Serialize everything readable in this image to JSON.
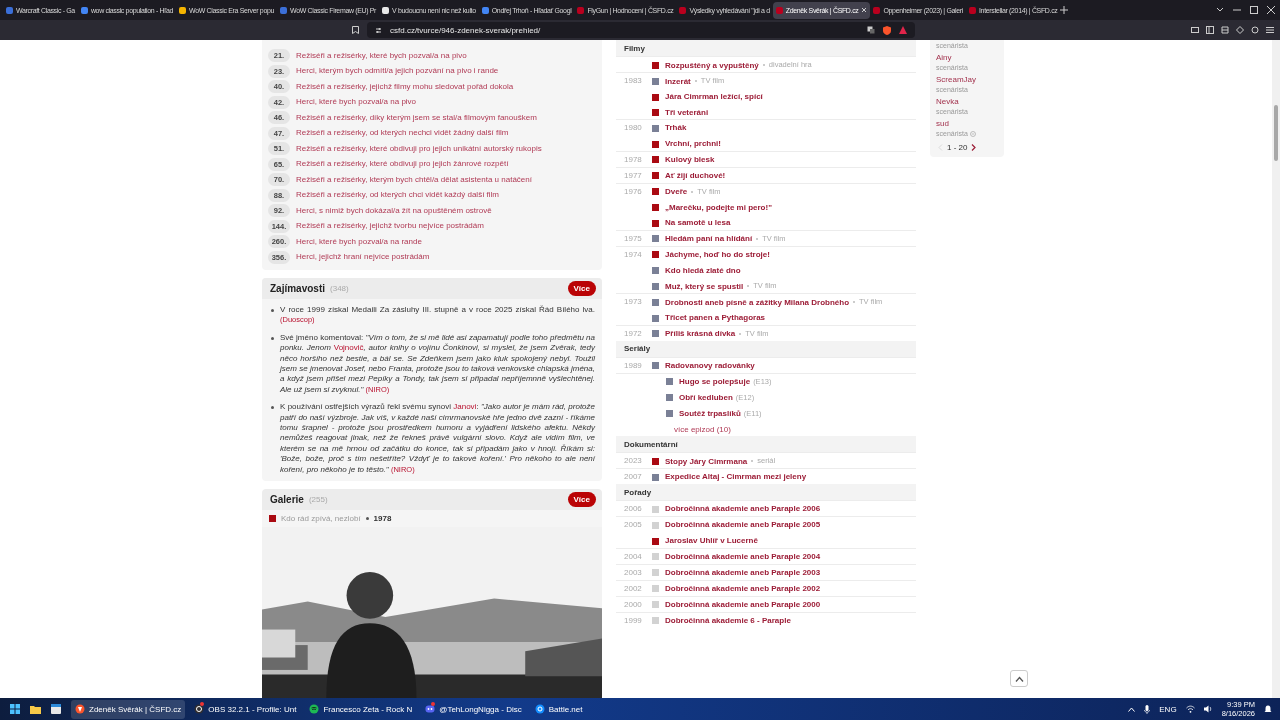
{
  "browser": {
    "tabs": [
      {
        "title": "Warcraft Classic - Ga",
        "selected": false
      },
      {
        "title": "wow classic population - Hľad",
        "selected": false
      },
      {
        "title": "WoW Classic Era Server popu",
        "selected": false
      },
      {
        "title": "WoW Classic Firemaw (EU) Pr",
        "selected": false
      },
      {
        "title": "V budoucnu není nic než kulto",
        "selected": false
      },
      {
        "title": "Ondřej Trhoň - Hľadať Googl",
        "selected": false
      },
      {
        "title": "FlyGun | Hodnocení | ČSFD.cz",
        "selected": false
      },
      {
        "title": "Výsledky vyhledávání \"jdi a d",
        "selected": false
      },
      {
        "title": "Zdeněk Svěrák | ČSFD.cz",
        "selected": true
      },
      {
        "title": "Oppenheimer (2023) | Galeri",
        "selected": false
      },
      {
        "title": "Interstellar (2014) | ČSFD.cz",
        "selected": false
      }
    ],
    "address_bar": {
      "url": "csfd.cz/tvurce/946-zdenek-sverak/prehled/"
    }
  },
  "rankings": [
    {
      "rank": "21.",
      "label": "Režiséři a režisérky, které bych pozval/a na pivo"
    },
    {
      "rank": "23.",
      "label": "Herci, kterým bych odmítl/a jejich pozvání na pivo i rande"
    },
    {
      "rank": "40.",
      "label": "Režiséři a režisérky, jejichž filmy mohu sledovat pořád dokola"
    },
    {
      "rank": "42.",
      "label": "Herci, které bych pozval/a na pivo"
    },
    {
      "rank": "46.",
      "label": "Režiséři a režisérky, díky kterým jsem se stal/a filmovým fanouškem"
    },
    {
      "rank": "47.",
      "label": "Režiséři a režisérky, od kterých nechci vidět žádný další film"
    },
    {
      "rank": "51.",
      "label": "Režiséři a režisérky, které obdivuji pro jejich unikátní autorský rukopis"
    },
    {
      "rank": "65.",
      "label": "Režiséři a režisérky, které obdivuji pro jejich žánrové rozpětí"
    },
    {
      "rank": "70.",
      "label": "Režiséři a režisérky, kterým bych chtěl/a dělat asistenta u natáčení"
    },
    {
      "rank": "88.",
      "label": "Režiséři a režisérky, od kterých chci vidět každý další film"
    },
    {
      "rank": "92.",
      "label": "Herci, s nimiž bych dokázal/a žít na opuštěném ostrově"
    },
    {
      "rank": "144.",
      "label": "Režiséři a režisérky, jejichž tvorbu nejvíce postrádám"
    },
    {
      "rank": "260.",
      "label": "Herci, které bych pozval/a na rande"
    },
    {
      "rank": "356.",
      "label": "Herci, jejichž hraní nejvíce postrádám"
    }
  ],
  "trivia": {
    "title": "Zajímavosti",
    "count": "(348)",
    "more_button": "Více",
    "items": [
      {
        "segments": [
          {
            "kind": "text",
            "italic": false,
            "text": "V roce 1999 získal Medaili Za zásluhy III. stupně a v roce 2025 získal Řád Bílého lva. "
          },
          {
            "kind": "source",
            "italic": false,
            "text": "(Duoscop)"
          }
        ]
      },
      {
        "segments": [
          {
            "kind": "text",
            "italic": false,
            "text": "Své jméno komentoval: "
          },
          {
            "kind": "text",
            "italic": true,
            "text": "\"Vím o tom, že si mě lidé asi zapamatují podle toho předmětu na ponku. Jenom "
          },
          {
            "kind": "link",
            "italic": false,
            "text": "Vojnovič"
          },
          {
            "kind": "text",
            "italic": true,
            "text": ", autor knihy o vojínu Čonkinovi, si myslel, že jsem Zvěrak, tedy něco horšího než bestie, a bál se. Se Zdeňkem jsem jako kluk spokojený nebyl. Toužil jsem se jmenovat Josef, nebo Franta, protože jsou to taková venkovské chlapská jména, a když jsem přišel mezi Pepíky a Tondy, tak jsem si připadal nepříjemnně vyšlechtěnej. Ale už jsem si zvyknul.\" "
          },
          {
            "kind": "source",
            "italic": false,
            "text": "(NIRO)"
          }
        ]
      },
      {
        "segments": [
          {
            "kind": "text",
            "italic": false,
            "text": "K používání ostřejších výrazů řekl svému synovi "
          },
          {
            "kind": "link",
            "italic": false,
            "text": "Janovi"
          },
          {
            "kind": "text",
            "italic": false,
            "text": ": "
          },
          {
            "kind": "text",
            "italic": true,
            "text": "\"Jako autor je mám rád, protože patří do naší výzbroje. Jak víš, v každé naší cimrmanovské hře jedno dvě zazní - říkáme tomu šrapnel - protože jsou prostředkem humoru a vyjádření lidského afektu. Někdy nemůžeš reagovat jinak, než že řekneš právě vulgární slovo. Když ale vidím film, ve kterém se na mě hrnou od začátku do konce, tak si připadám jako v hnoji. Říkám si: 'Bože, bože, proč s tím nešetříte? Vždyť je to takové koření.' Pro někoho to ale není koření, pro někoho je to těsto.\" "
          },
          {
            "kind": "source",
            "italic": false,
            "text": "(NIRO)"
          }
        ]
      }
    ]
  },
  "gallery": {
    "title": "Galerie",
    "count": "(255)",
    "more_button": "Více",
    "caption": {
      "title": "Kdo rád zpívá, nezlobí",
      "year": "1978",
      "color": "#aa0a12"
    }
  },
  "filmography": {
    "sections": [
      {
        "title": "Filmy",
        "rows": [
          {
            "year": "",
            "title": "Rozpuštěný a vypuštěný",
            "note": "divadelní hra",
            "color": "#aa0a12"
          },
          {
            "year": "1983",
            "title": "Inzerát",
            "note": "TV film",
            "color": "#7a8096"
          },
          {
            "year": "",
            "title": "Jára Cimrman ležící, spící",
            "color": "#aa0a12"
          },
          {
            "year": "",
            "title": "Tři veteráni",
            "color": "#aa0a12"
          },
          {
            "year": "1980",
            "title": "Trhák",
            "color": "#7a8096"
          },
          {
            "year": "",
            "title": "Vrchní, prchni!",
            "color": "#aa0a12"
          },
          {
            "year": "1978",
            "title": "Kulový blesk",
            "color": "#aa0a12"
          },
          {
            "year": "1977",
            "title": "Ať žijí duchové!",
            "color": "#aa0a12"
          },
          {
            "year": "1976",
            "title": "Dveře",
            "note": "TV film",
            "color": "#aa0a12"
          },
          {
            "year": "",
            "title": "„Marečku, podejte mi pero!\"",
            "color": "#aa0a12"
          },
          {
            "year": "",
            "title": "Na samotě u lesa",
            "color": "#aa0a12"
          },
          {
            "year": "1975",
            "title": "Hledám paní na hlídání",
            "note": "TV film",
            "color": "#7a8096"
          },
          {
            "year": "1974",
            "title": "Jáchyme, hoď ho do stroje!",
            "color": "#aa0a12"
          },
          {
            "year": "",
            "title": "Kdo hledá zlaté dno",
            "color": "#7a8096"
          },
          {
            "year": "",
            "title": "Muž, který se spustil",
            "note": "TV film",
            "color": "#7a8096"
          },
          {
            "year": "1973",
            "title": "Drobnosti aneb písně a zážitky Milana Drobného",
            "note": "TV film",
            "color": "#7a8096"
          },
          {
            "year": "",
            "title": "Třicet panen a Pythagoras",
            "color": "#7a8096"
          },
          {
            "year": "1972",
            "title": "Příliš krásná dívka",
            "note": "TV film",
            "color": "#7a8096"
          }
        ]
      },
      {
        "title": "Seriály",
        "rows": [
          {
            "year": "1989",
            "title": "Radovanovy radovánky",
            "color": "#7a8096",
            "children": [
              {
                "title": "Hugo se polepšuje",
                "episode": "(E13)",
                "color": "#7a8096"
              },
              {
                "title": "Obří kedluben",
                "episode": "(E12)",
                "color": "#7a8096"
              },
              {
                "title": "Soutěž trpaslíků",
                "episode": "(E11)",
                "color": "#7a8096"
              }
            ],
            "more": "více epizod (10)"
          }
        ]
      },
      {
        "title": "Dokumentární",
        "rows": [
          {
            "year": "2023",
            "title": "Stopy Járy Cimrmana",
            "note": "seriál",
            "color": "#aa0a12"
          },
          {
            "year": "2007",
            "title": "Expedice Altaj - Cimrman mezi jeleny",
            "color": "#7a8096"
          }
        ]
      },
      {
        "title": "Pořady",
        "rows": [
          {
            "year": "2006",
            "title": "Dobročinná akademie aneb Paraple 2006",
            "color": "#d2d2d2"
          },
          {
            "year": "2005",
            "title": "Dobročinná akademie aneb Paraple 2005",
            "color": "#d2d2d2"
          },
          {
            "year": "",
            "title": "Jaroslav Uhlíř v Lucerně",
            "color": "#aa0a12"
          },
          {
            "year": "2004",
            "title": "Dobročinná akademie aneb Paraple 2004",
            "color": "#d2d2d2"
          },
          {
            "year": "2003",
            "title": "Dobročinná akademie aneb Paraple 2003",
            "color": "#d2d2d2"
          },
          {
            "year": "2002",
            "title": "Dobročinná akademie aneb Paraple 2002",
            "color": "#d2d2d2"
          },
          {
            "year": "2000",
            "title": "Dobročinná akademie aneb Paraple 2000",
            "color": "#d2d2d2"
          },
          {
            "year": "1999",
            "title": "Dobročinná akademie 6 - Paraple",
            "color": "#d2d2d2"
          }
        ]
      }
    ]
  },
  "credits_card": {
    "entries": [
      {
        "role": "scenárista",
        "flagged": false
      },
      {
        "name": "Ainy",
        "role": "scenárista",
        "flagged": false
      },
      {
        "name": "ScreamJay",
        "role": "scenárista",
        "flagged": false
      },
      {
        "name": "Nevka",
        "role": "scenárista",
        "flagged": false
      },
      {
        "name": "sud",
        "role": "scenárista",
        "flagged": true
      }
    ],
    "pager": {
      "range": "1 - 20",
      "previous_disabled": true
    }
  },
  "taskbar": {
    "apps": [
      {
        "label": "Zdeněk Svěrák | ČSFD.cz",
        "active": true,
        "notification": false
      },
      {
        "label": "OBS 32.2.1 - Profile: Unt",
        "active": false,
        "notification": true
      },
      {
        "label": "Francesco Zeta - Rock N",
        "active": false,
        "notification": false
      },
      {
        "label": "@TehLongNigga - Disc",
        "active": false,
        "notification": true
      },
      {
        "label": "Battle.net",
        "active": false,
        "notification": false
      }
    ],
    "tray": {
      "language": "ENG",
      "time": "9:39 PM",
      "date": "8/16/2026"
    }
  }
}
